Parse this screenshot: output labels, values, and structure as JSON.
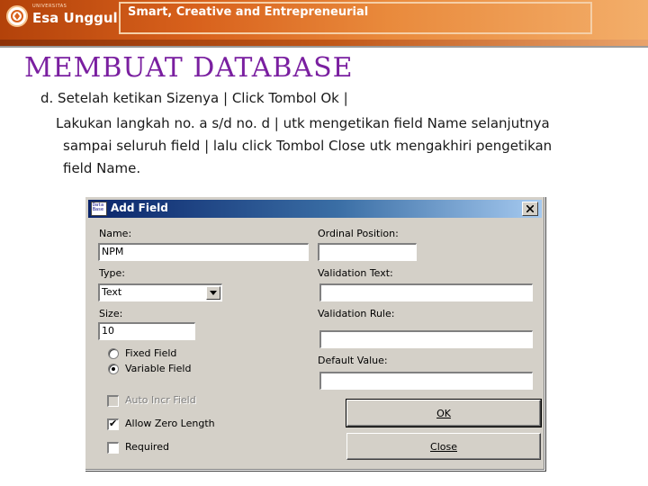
{
  "header": {
    "logo_sub": "UNIVERSITAS",
    "logo_name": "Esa Unggul",
    "tagline": "Smart, Creative and Entrepreneurial",
    "colors": {
      "banner": "#d8611c",
      "title": "#7a1fa0"
    }
  },
  "slide": {
    "title": "MEMBUAT  DATABASE",
    "lines": [
      "d. Setelah ketikan Sizenya  |  Click Tombol Ok  |",
      "Lakukan langkah no. a  s/d  no. d   |  utk mengetikan field Name selanjutnya",
      "sampai seluruh field  | lalu click Tombol Close utk mengakhiri pengetikan",
      "field Name."
    ]
  },
  "dialog": {
    "title": "Add Field",
    "icon_text": "Data Base",
    "close_symbol": "✕",
    "left": {
      "name_label": "Name:",
      "name_value": "NPM",
      "type_label": "Type:",
      "type_value": "Text",
      "size_label": "Size:",
      "size_value": "10",
      "fixed_label": "Fixed Field",
      "variable_label": "Variable Field",
      "auto_incr_label": "Auto Incr Field",
      "allow_zero_label": "Allow Zero Length",
      "required_label": "Required"
    },
    "right": {
      "ordinal_label": "Ordinal Position:",
      "ordinal_value": "",
      "validation_text_label": "Validation Text:",
      "validation_text_value": "",
      "validation_rule_label": "Validation Rule:",
      "validation_rule_value": "",
      "default_label": "Default Value:",
      "default_value": ""
    },
    "buttons": {
      "ok": "OK",
      "close": "Close"
    },
    "state": {
      "variable_field_selected": true,
      "allow_zero_length_checked": true,
      "auto_incr_field_enabled": false,
      "required_checked": false
    }
  }
}
